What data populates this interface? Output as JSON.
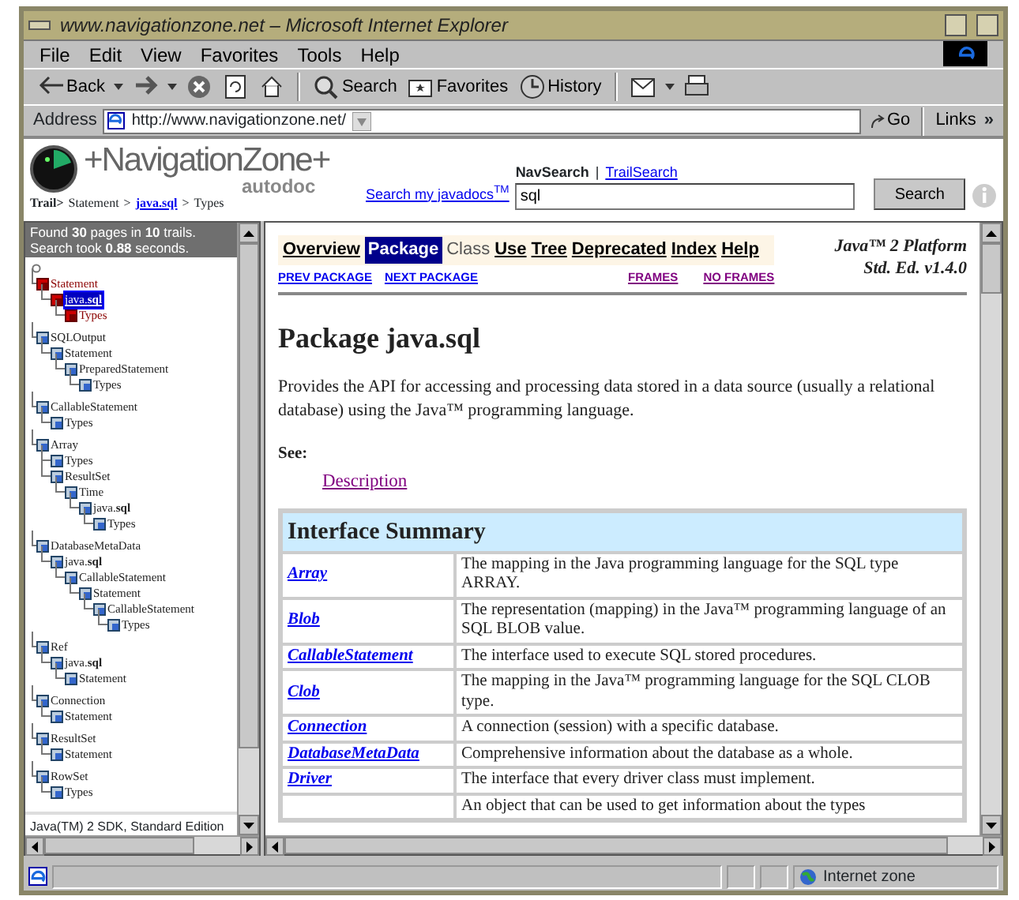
{
  "window": {
    "title": "www.navigationzone.net – Microsoft Internet Explorer"
  },
  "menu": [
    "File",
    "Edit",
    "View",
    "Favorites",
    "Tools",
    "Help"
  ],
  "toolbar": [
    {
      "kind": "back",
      "label": "Back",
      "dropdown": true
    },
    {
      "kind": "forward",
      "dropdown": true
    },
    {
      "kind": "stop"
    },
    {
      "kind": "refresh"
    },
    {
      "kind": "home"
    },
    {
      "kind": "search",
      "label": "Search",
      "separator_before": true
    },
    {
      "kind": "favorites",
      "label": "Favorites"
    },
    {
      "kind": "history",
      "label": "History"
    },
    {
      "kind": "mail",
      "dropdown": true,
      "separator_before": true
    },
    {
      "kind": "print"
    }
  ],
  "address": {
    "label": "Address",
    "url": "http://www.navigationzone.net/",
    "go": "Go",
    "links": "Links",
    "more": "»"
  },
  "site_header": {
    "logo_text": "+NavigationZone+",
    "logo_sub": "autodoc",
    "trail_label": "Trail>",
    "trail": [
      {
        "kind": "crumb",
        "text": "Statement"
      },
      {
        "kind": "sep",
        "text": ">"
      },
      {
        "kind": "link",
        "text": "java.sql"
      },
      {
        "kind": "sep",
        "text": ">"
      },
      {
        "kind": "crumb",
        "text": "Types"
      }
    ],
    "search_tab": "NavSearch",
    "search_divider": "|",
    "search_tab_link": "TrailSearch",
    "search_prompt": "Search my javadocs$^{TM}$",
    "search_value": "sql",
    "search_button": "Search"
  },
  "results": {
    "summary": "Found **30** pages in **10** trails.",
    "timing": "Search took **0.88** seconds."
  },
  "tree": [
    {
      "label": "Statement",
      "current": true,
      "selected": false,
      "children": [
        {
          "label": "java.**sql**",
          "current": true,
          "selected": true,
          "children": [
            {
              "label": "Types",
              "current": true,
              "selected": false
            }
          ]
        }
      ]
    },
    {
      "label": "SQLOutput",
      "current": false,
      "selected": false,
      "children": [
        {
          "label": "Statement",
          "current": false,
          "selected": false,
          "children": [
            {
              "label": "PreparedStatement",
              "current": false,
              "selected": false,
              "children": [
                {
                  "label": "Types",
                  "current": false,
                  "selected": false
                }
              ]
            }
          ]
        }
      ]
    },
    {
      "label": "CallableStatement",
      "current": false,
      "selected": false,
      "children": [
        {
          "label": "Types",
          "current": false,
          "selected": false
        }
      ]
    },
    {
      "label": "Array",
      "current": false,
      "selected": false,
      "children": [
        {
          "label": "Types",
          "current": false,
          "selected": false
        },
        {
          "label": "ResultSet",
          "current": false,
          "selected": false,
          "children": [
            {
              "label": "Time",
              "current": false,
              "selected": false,
              "children": [
                {
                  "label": "java.**sql**",
                  "current": false,
                  "selected": false,
                  "children": [
                    {
                      "label": "Types",
                      "current": false,
                      "selected": false
                    }
                  ]
                }
              ]
            }
          ]
        }
      ]
    },
    {
      "label": "DatabaseMetaData",
      "current": false,
      "selected": false,
      "children": [
        {
          "label": "java.**sql**",
          "current": false,
          "selected": false,
          "children": [
            {
              "label": "CallableStatement",
              "current": false,
              "selected": false,
              "children": [
                {
                  "label": "Statement",
                  "current": false,
                  "selected": false,
                  "children": [
                    {
                      "label": "CallableStatement",
                      "current": false,
                      "selected": false,
                      "children": [
                        {
                          "label": "Types",
                          "current": false,
                          "selected": false
                        }
                      ]
                    }
                  ]
                }
              ]
            }
          ]
        }
      ]
    },
    {
      "label": "Ref",
      "current": false,
      "selected": false,
      "children": [
        {
          "label": "java.**sql**",
          "current": false,
          "selected": false,
          "children": [
            {
              "label": "Statement",
              "current": false,
              "selected": false
            }
          ]
        }
      ]
    },
    {
      "label": "Connection",
      "current": false,
      "selected": false,
      "children": [
        {
          "label": "Statement",
          "current": false,
          "selected": false
        }
      ]
    },
    {
      "label": "ResultSet",
      "current": false,
      "selected": false,
      "children": [
        {
          "label": "Statement",
          "current": false,
          "selected": false
        }
      ]
    },
    {
      "label": "RowSet",
      "current": false,
      "selected": false,
      "children": [
        {
          "label": "Types",
          "current": false,
          "selected": false
        }
      ]
    }
  ],
  "left_footer": "Java(TM) 2 SDK, Standard Edition",
  "doc": {
    "nav": [
      {
        "label": "Overview",
        "selected": false,
        "disabled": false
      },
      {
        "label": "Package",
        "selected": true,
        "disabled": false
      },
      {
        "label": "Class",
        "selected": false,
        "disabled": true
      },
      {
        "label": "Use",
        "selected": false,
        "disabled": false
      },
      {
        "label": "Tree",
        "selected": false,
        "disabled": false
      },
      {
        "label": "Deprecated",
        "selected": false,
        "disabled": false
      },
      {
        "label": "Index",
        "selected": false,
        "disabled": false
      },
      {
        "label": "Help",
        "selected": false,
        "disabled": false
      }
    ],
    "platform": [
      "Java™ 2 Platform",
      "Std. Ed. v1.4.0"
    ],
    "subnav_left": [
      {
        "label": "PREV PACKAGE",
        "visited": false
      },
      {
        "label": "NEXT PACKAGE",
        "visited": false
      }
    ],
    "subnav_right": [
      {
        "label": "FRAMES",
        "visited": true
      },
      {
        "label": "NO FRAMES",
        "visited": true
      }
    ],
    "title": "Package java.sql",
    "intro": "Provides the API for accessing and processing data stored in a data source (usually a relational database) using the Java™ programming language.",
    "see_label": "See:",
    "see_link": "Description",
    "summary": {
      "title": "Interface Summary",
      "rows": [
        {
          "name": "Array",
          "description": "The mapping in the Java programming language for the SQL type ARRAY."
        },
        {
          "name": "Blob",
          "description": "The representation (mapping) in the Java™ programming language of an SQL BLOB value."
        },
        {
          "name": "CallableStatement",
          "description": "The interface used to execute SQL stored procedures."
        },
        {
          "name": "Clob",
          "description": "The mapping in the Java™ programming language for the SQL CLOB type."
        },
        {
          "name": "Connection",
          "description": "A connection (session) with a specific database."
        },
        {
          "name": "DatabaseMetaData",
          "description": "Comprehensive information about the database as a whole."
        },
        {
          "name": "Driver",
          "description": "The interface that every driver class must implement."
        },
        {
          "description": "An object that can be used to get information about the types"
        }
      ]
    }
  },
  "status": {
    "zone": "Internet zone"
  }
}
